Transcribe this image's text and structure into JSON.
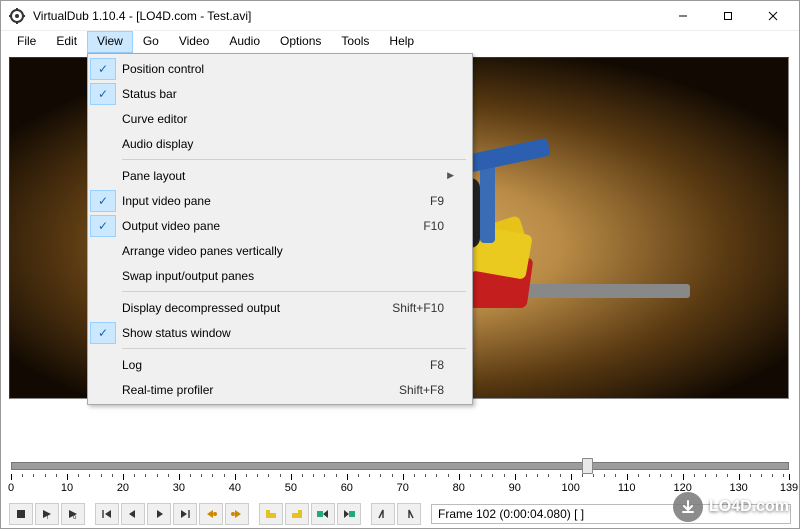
{
  "window": {
    "title": "VirtualDub 1.10.4 - [LO4D.com - Test.avi]"
  },
  "menubar": [
    "File",
    "Edit",
    "View",
    "Go",
    "Video",
    "Audio",
    "Options",
    "Tools",
    "Help"
  ],
  "active_menu_index": 2,
  "dropdown": {
    "items": [
      {
        "label": "Position control",
        "checked": true
      },
      {
        "label": "Status bar",
        "checked": true
      },
      {
        "label": "Curve editor",
        "checked": false
      },
      {
        "label": "Audio display",
        "checked": false
      },
      {
        "sep": true
      },
      {
        "label": "Pane layout",
        "submenu": true,
        "checked": false
      },
      {
        "label": "Input video pane",
        "checked": true,
        "shortcut": "F9"
      },
      {
        "label": "Output video pane",
        "checked": true,
        "shortcut": "F10"
      },
      {
        "label": "Arrange video panes vertically",
        "checked": false
      },
      {
        "label": "Swap input/output panes",
        "checked": false
      },
      {
        "sep": true
      },
      {
        "label": "Display decompressed output",
        "checked": false,
        "shortcut": "Shift+F10"
      },
      {
        "label": "Show status window",
        "checked": true
      },
      {
        "sep": true
      },
      {
        "label": "Log",
        "checked": false,
        "shortcut": "F8"
      },
      {
        "label": "Real-time profiler",
        "checked": false,
        "shortcut": "Shift+F8"
      }
    ]
  },
  "timeline": {
    "labels": [
      "0",
      "10",
      "20",
      "30",
      "40",
      "50",
      "60",
      "70",
      "80",
      "90",
      "100",
      "110",
      "120",
      "130",
      "139"
    ],
    "max": 139,
    "position": 102
  },
  "status": {
    "frame_text": "Frame 102 (0:00:04.080) [ ]"
  },
  "toolbar_icons": [
    "stop",
    "play-in",
    "play-out",
    "gap",
    "seek-start",
    "step-back",
    "step-fwd",
    "seek-end",
    "key-prev",
    "key-next",
    "gap",
    "mark-a",
    "mark-b",
    "scene-prev",
    "scene-next",
    "gap",
    "mark-in",
    "mark-out"
  ],
  "watermark": "LO4D.com"
}
